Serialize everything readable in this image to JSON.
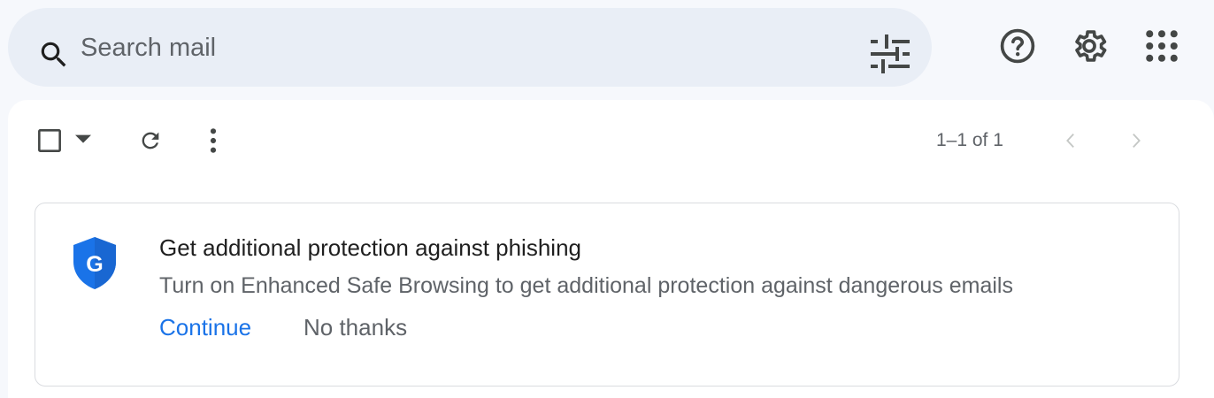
{
  "search": {
    "placeholder": "Search mail",
    "value": ""
  },
  "header": {
    "icons": [
      "search-icon",
      "tune-icon",
      "help-icon",
      "settings-gear-icon",
      "apps-grid-icon"
    ]
  },
  "toolbar": {
    "pagination": "1–1 of 1",
    "icons": [
      "checkbox-icon",
      "select-dropdown-icon",
      "refresh-icon",
      "more-vert-icon",
      "chevron-left-icon",
      "chevron-right-icon"
    ]
  },
  "promo": {
    "icon": "google-shield-icon",
    "title": "Get additional protection against phishing",
    "description": "Turn on Enhanced Safe Browsing to get additional protection against dangerous emails",
    "continue_label": "Continue",
    "dismiss_label": "No thanks"
  },
  "colors": {
    "background": "#f6f8fc",
    "search_bg": "#e9eef6",
    "accent_blue": "#1a73e8",
    "shield_blue": "#1a73e8",
    "icon_dark": "#444746",
    "text_secondary": "#5f6368"
  }
}
